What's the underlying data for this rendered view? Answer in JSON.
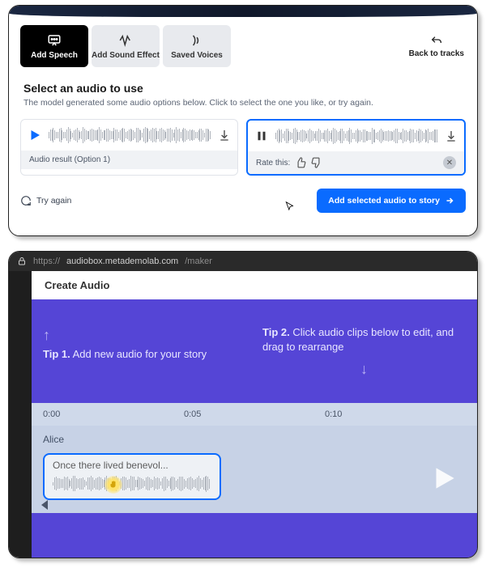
{
  "panel1": {
    "tabs": [
      {
        "label": "Add Speech",
        "active": true
      },
      {
        "label": "Add Sound Effect",
        "active": false
      },
      {
        "label": "Saved Voices",
        "active": false
      }
    ],
    "back_label": "Back to tracks",
    "title": "Select an audio to use",
    "subtitle": "The model generated some audio options below. Click to select the one you like, or try again.",
    "option1": {
      "footer": "Audio result (Option 1)"
    },
    "option2": {
      "footer": "Rate this:"
    },
    "try_again": "Try again",
    "add_button": "Add selected audio to story"
  },
  "panel2": {
    "url_host": "audiobox.metademolab.com",
    "url_path": "/maker",
    "heading": "Create Audio",
    "tip1_prefix": "Tip 1.",
    "tip1_text": " Add new audio for your story",
    "tip2_prefix": "Tip 2.",
    "tip2_text": " Click audio clips below to edit, and drag to rearrange",
    "time_marks": [
      "0:00",
      "0:05",
      "0:10"
    ],
    "track_name": "Alice",
    "clip_label": "Once there lived benevol..."
  }
}
